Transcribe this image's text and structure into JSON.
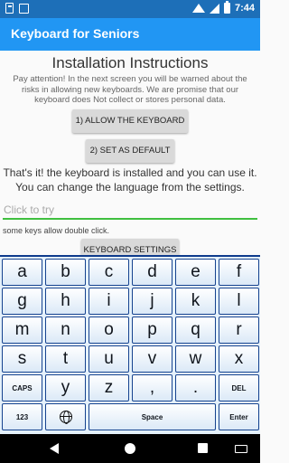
{
  "status_bar": {
    "time": "7:44",
    "icons": [
      "sd-card-icon",
      "notification-box-icon",
      "wifi-icon",
      "signal-icon",
      "battery-icon"
    ]
  },
  "app_bar": {
    "title": "Keyboard for Seniors",
    "color": "#2196f3"
  },
  "main": {
    "title": "Installation Instructions",
    "description": "Pay attention! In the next screen you will be warned about the risks in allowing new keyboards. We are promise that our keyboard does Not collect or stores personal data.",
    "allow_button": "1) ALLOW THE KEYBOARD",
    "default_button": "2) SET AS DEFAULT",
    "done_text": "That's it! the keyboard is installed and you can use it. You can change the language from the settings.",
    "try_input": {
      "value": "",
      "placeholder": "Click to try"
    },
    "hint": "some keys allow double click.",
    "settings_button": "KEYBOARD SETTINGS"
  },
  "keyboard": {
    "rows": [
      [
        "a",
        "b",
        "c",
        "d",
        "e",
        "f"
      ],
      [
        "g",
        "h",
        "i",
        "j",
        "k",
        "l"
      ],
      [
        "m",
        "n",
        "o",
        "p",
        "q",
        "r"
      ],
      [
        "s",
        "t",
        "u",
        "v",
        "w",
        "x"
      ],
      [
        "CAPS",
        "y",
        "z",
        ",",
        ".",
        "DEL"
      ],
      [
        "123",
        "globe-icon",
        "Space",
        "Enter"
      ]
    ]
  },
  "nav_bar": {
    "icons": [
      "back-icon",
      "home-icon",
      "recents-icon",
      "keyboard-icon"
    ]
  }
}
